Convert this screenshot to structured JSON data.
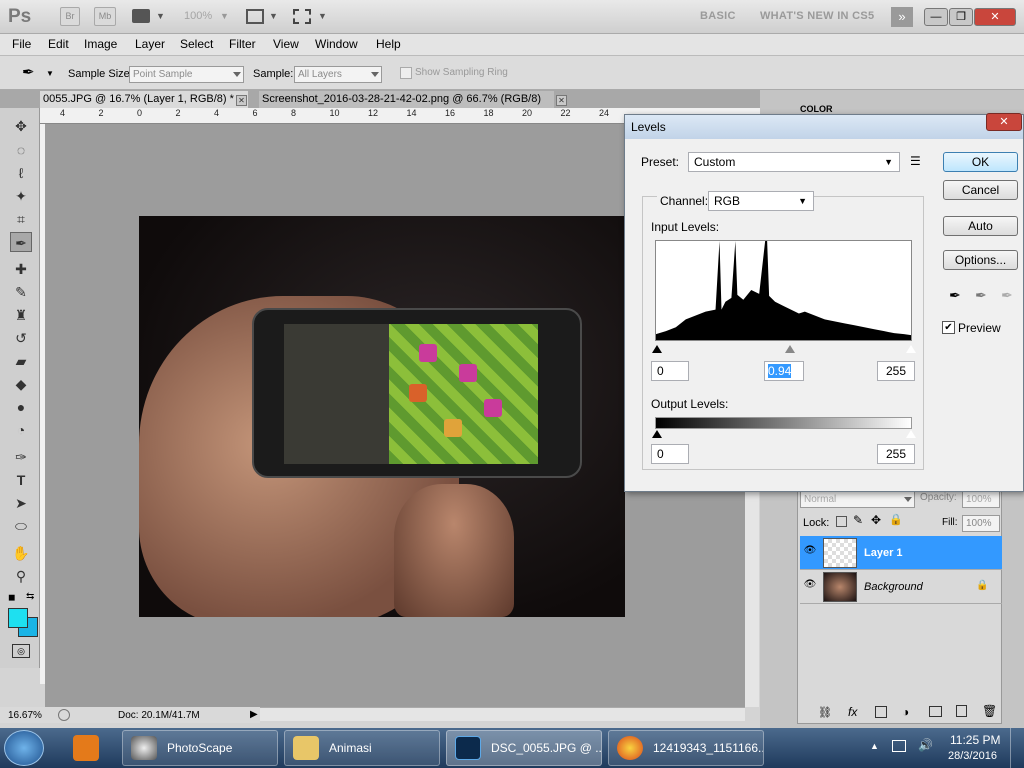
{
  "app": {
    "logo": "Ps",
    "bridge": "Br",
    "minibridge": "Mb",
    "zoom": "100%",
    "workspace": "BASIC",
    "whats_new": "WHAT'S NEW IN CS5"
  },
  "menu": [
    "File",
    "Edit",
    "Image",
    "Layer",
    "Select",
    "Filter",
    "View",
    "Window",
    "Help"
  ],
  "options": {
    "sample_size_label": "Sample Size:",
    "sample_size_value": "Point Sample",
    "sample_label": "Sample:",
    "sample_value": "All Layers",
    "show_ring": "Show Sampling Ring"
  },
  "tabs": [
    {
      "label": "0055.JPG @ 16.7% (Layer 1, RGB/8) *"
    },
    {
      "label": "Screenshot_2016-03-28-21-42-02.png @ 66.7% (RGB/8)"
    }
  ],
  "ruler": [
    "4",
    "2",
    "0",
    "2",
    "4",
    "6",
    "8",
    "10",
    "12",
    "14",
    "16",
    "18",
    "20",
    "22",
    "24"
  ],
  "status": {
    "zoom": "16.67%",
    "doc": "Doc: 20.1M/41.7M"
  },
  "panel": {
    "color_tab": "COLOR",
    "blend": "Normal",
    "opacity_label": "Opacity:",
    "opacity": "100%",
    "lock_label": "Lock:",
    "fill_label": "Fill:",
    "fill": "100%",
    "layers": [
      {
        "name": "Layer 1"
      },
      {
        "name": "Background"
      }
    ]
  },
  "levels": {
    "title": "Levels",
    "preset_label": "Preset:",
    "preset": "Custom",
    "channel_label": "Channel:",
    "channel": "RGB",
    "input_label": "Input Levels:",
    "input_black": "0",
    "input_gamma": "0.94",
    "input_white": "255",
    "output_label": "Output Levels:",
    "output_black": "0",
    "output_white": "255",
    "ok": "OK",
    "cancel": "Cancel",
    "auto": "Auto",
    "options": "Options...",
    "preview": "Preview"
  },
  "taskbar": {
    "items": [
      "PhotoScape",
      "Animasi",
      "DSC_0055.JPG @ ...",
      "12419343_1151166..."
    ],
    "time": "11:25 PM",
    "date": "28/3/2016"
  },
  "colors": {
    "foreground": "#1ee0f0",
    "background": "#1ab4e6",
    "selection": "#3399ff"
  }
}
